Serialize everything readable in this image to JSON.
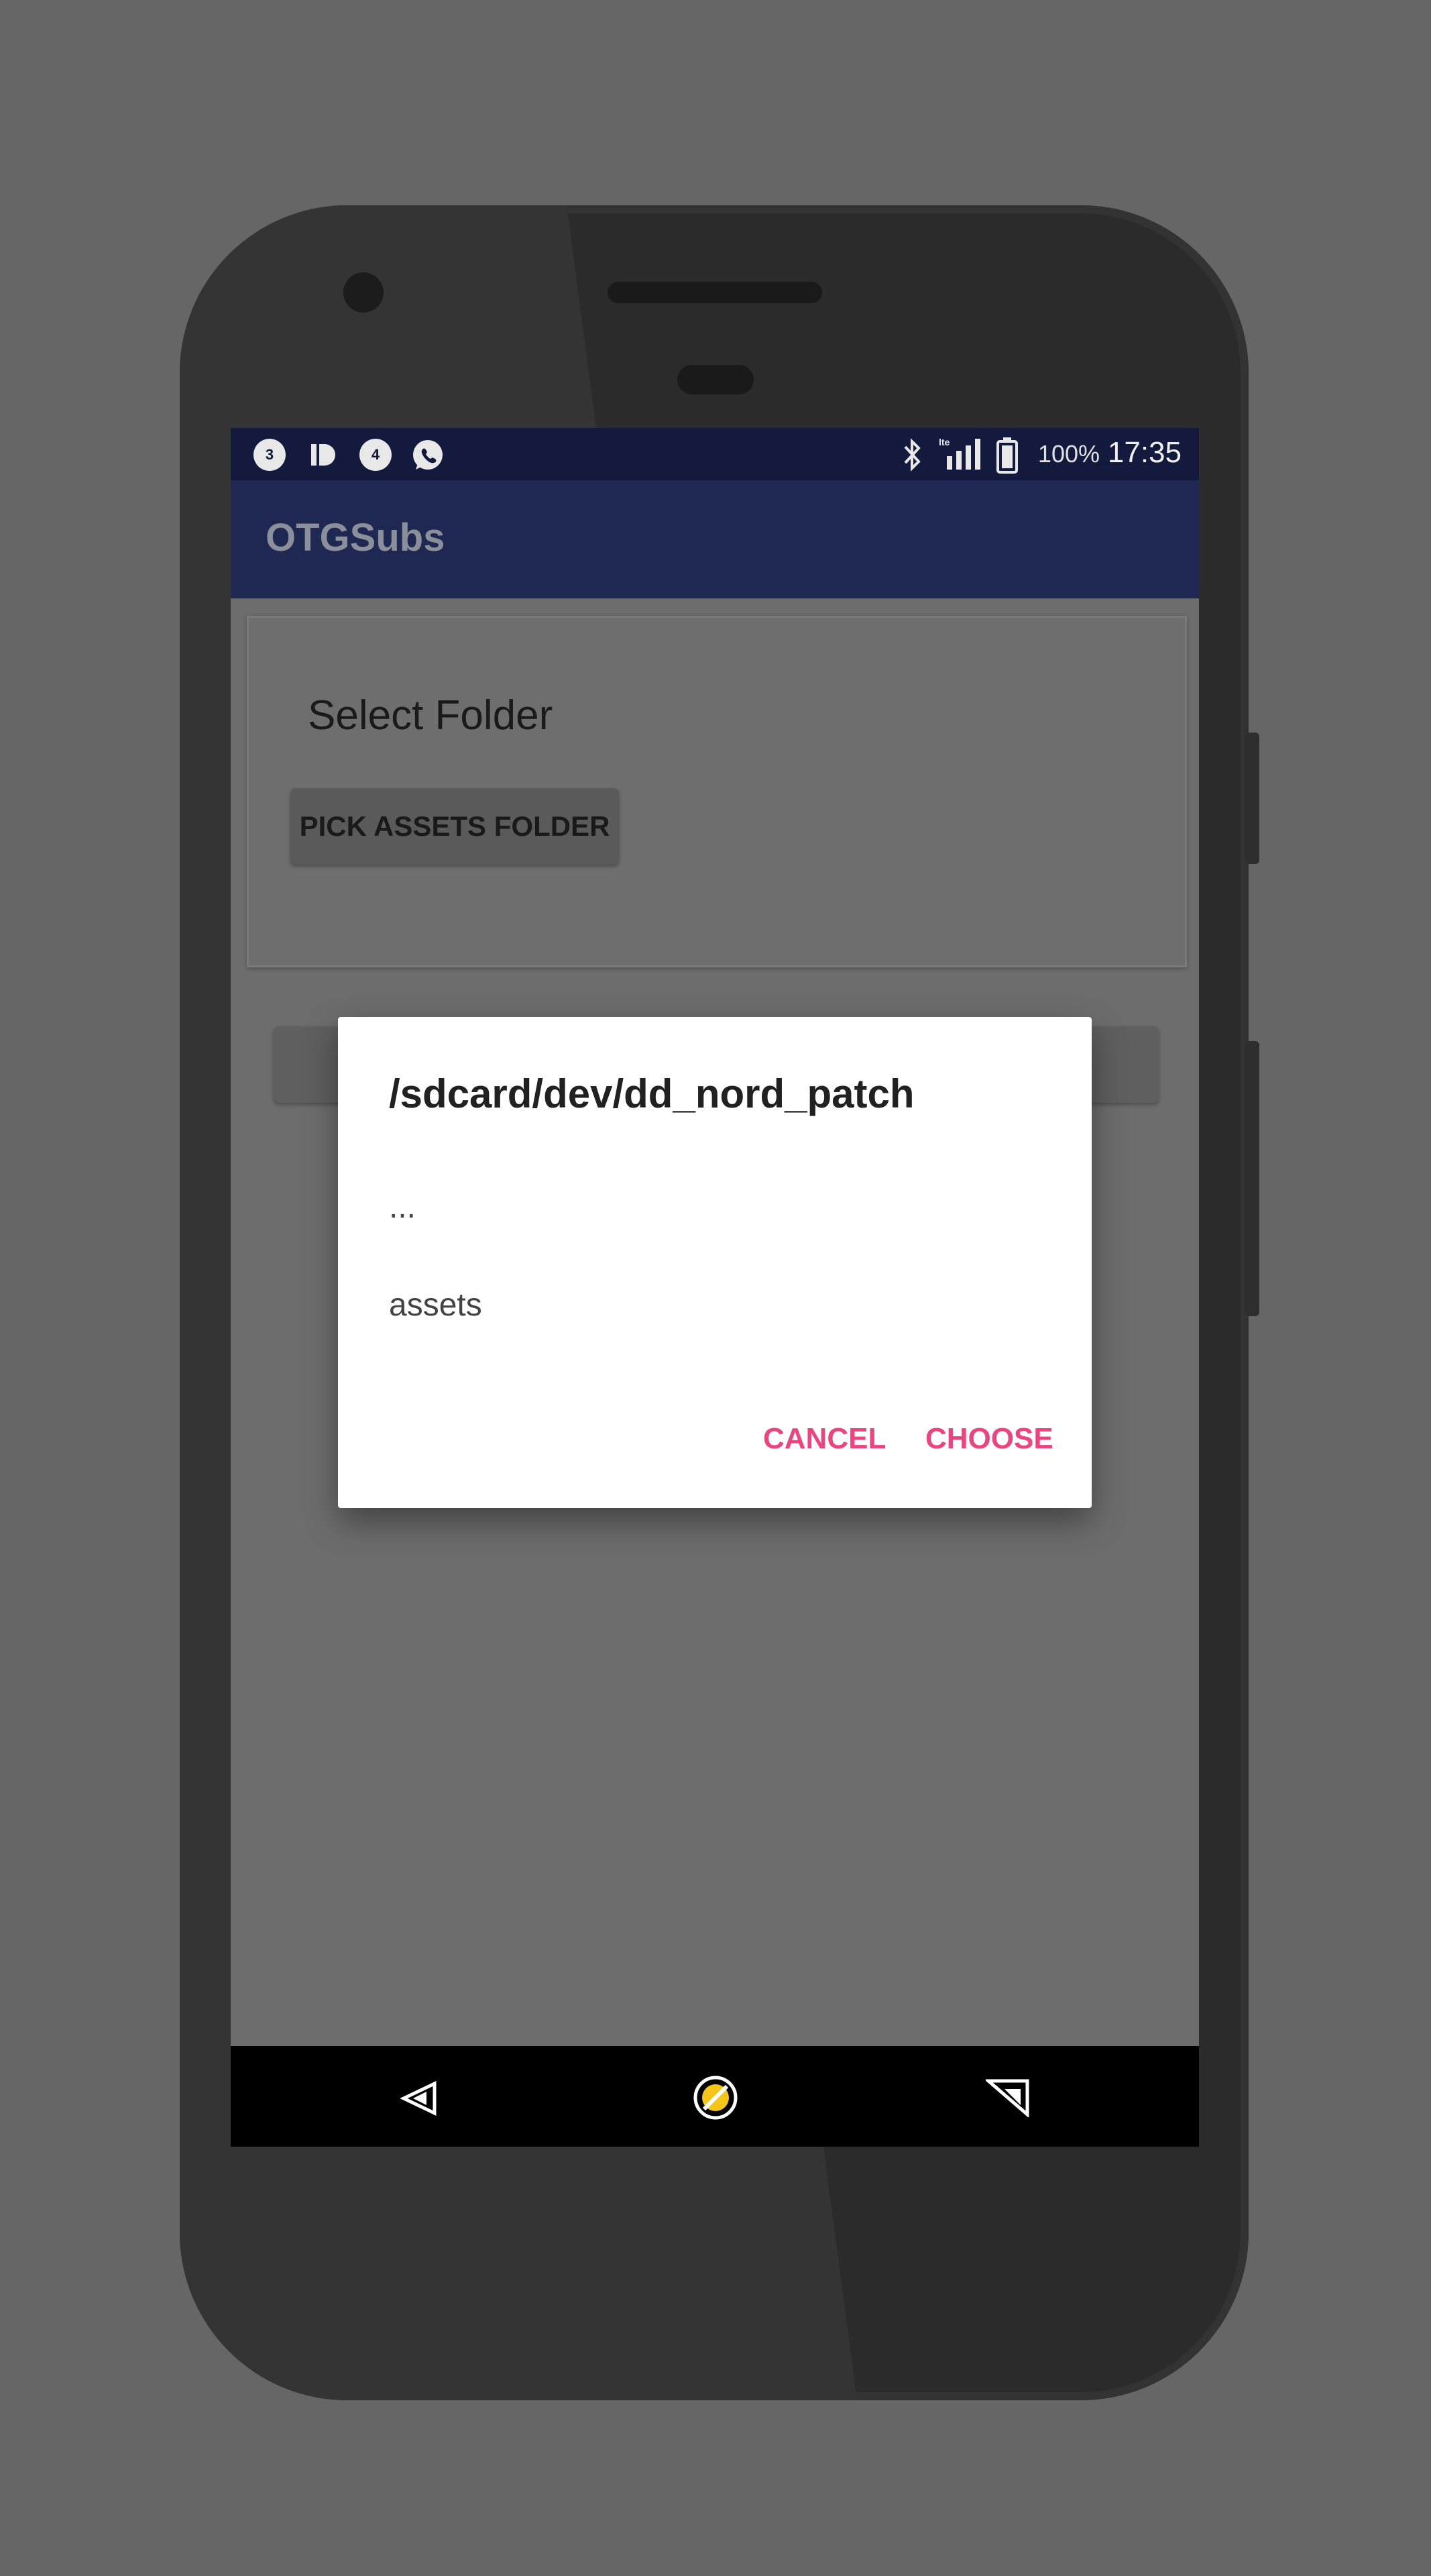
{
  "status_bar": {
    "notification_icons": [
      "notification-3-icon",
      "id-app-icon",
      "notification-4-icon",
      "whatsapp-icon"
    ],
    "notification_badges": [
      "3",
      "4"
    ],
    "battery": "100%",
    "time": "17:35",
    "network": "lte"
  },
  "app_bar": {
    "title": "OTGSubs"
  },
  "card": {
    "title": "Select Folder",
    "button_label": "PICK ASSETS FOLDER"
  },
  "dialog": {
    "title": "/sdcard/dev/dd_nord_patch",
    "items": [
      "...",
      "assets"
    ],
    "cancel_label": "CANCEL",
    "choose_label": "CHOOSE",
    "accent_color": "#ee4281"
  },
  "nav_bar": {
    "icons": [
      "back-icon",
      "home-icon",
      "recents-icon"
    ]
  }
}
